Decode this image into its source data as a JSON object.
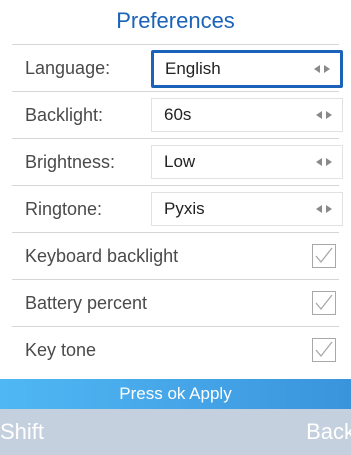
{
  "header": {
    "title": "Preferences"
  },
  "settings": [
    {
      "label": "Language:",
      "value": "English"
    },
    {
      "label": "Backlight:",
      "value": "60s"
    },
    {
      "label": "Brightness:",
      "value": "Low"
    },
    {
      "label": "Ringtone:",
      "value": "Pyxis"
    }
  ],
  "toggles": [
    {
      "label": "Keyboard backlight",
      "checked": true
    },
    {
      "label": "Battery percent",
      "checked": true
    },
    {
      "label": "Key tone",
      "checked": true
    }
  ],
  "apply_bar": {
    "text": "Press ok Apply"
  },
  "softkeys": {
    "left": "Shift",
    "right": "Back"
  },
  "colors": {
    "accent": "#1a63b8",
    "apply_bar": "#46a6e8",
    "softkey_bar": "#c5d0de"
  },
  "icons": {
    "selector": "left-right-arrows-icon",
    "checkbox": "checkmark-icon"
  }
}
